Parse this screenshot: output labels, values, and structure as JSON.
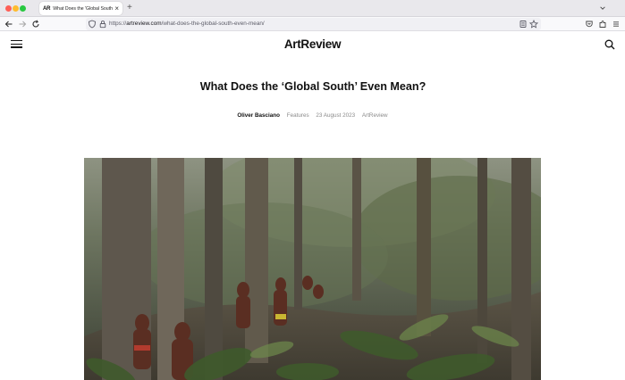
{
  "browser": {
    "tab": {
      "favicon_text": "AR",
      "title": "What Does the 'Global South' E"
    },
    "url": {
      "scheme": "https://",
      "host": "artreview.com",
      "path": "/what-does-the-global-south-even-mean/"
    }
  },
  "site": {
    "logo": "ArtReview"
  },
  "article": {
    "headline": "What Does the ‘Global South’ Even Mean?",
    "author": "Oliver Basciano",
    "section": "Features",
    "date": "23 August 2023",
    "publication": "ArtReview"
  },
  "colors": {
    "accent": "#111111",
    "meta_gray": "#8a8a8a"
  },
  "icons": [
    "menu-icon",
    "search-icon",
    "shield-icon",
    "lock-icon",
    "reader-view-icon",
    "bookmark-star-icon",
    "pocket-icon",
    "extensions-icon",
    "app-menu-icon"
  ]
}
